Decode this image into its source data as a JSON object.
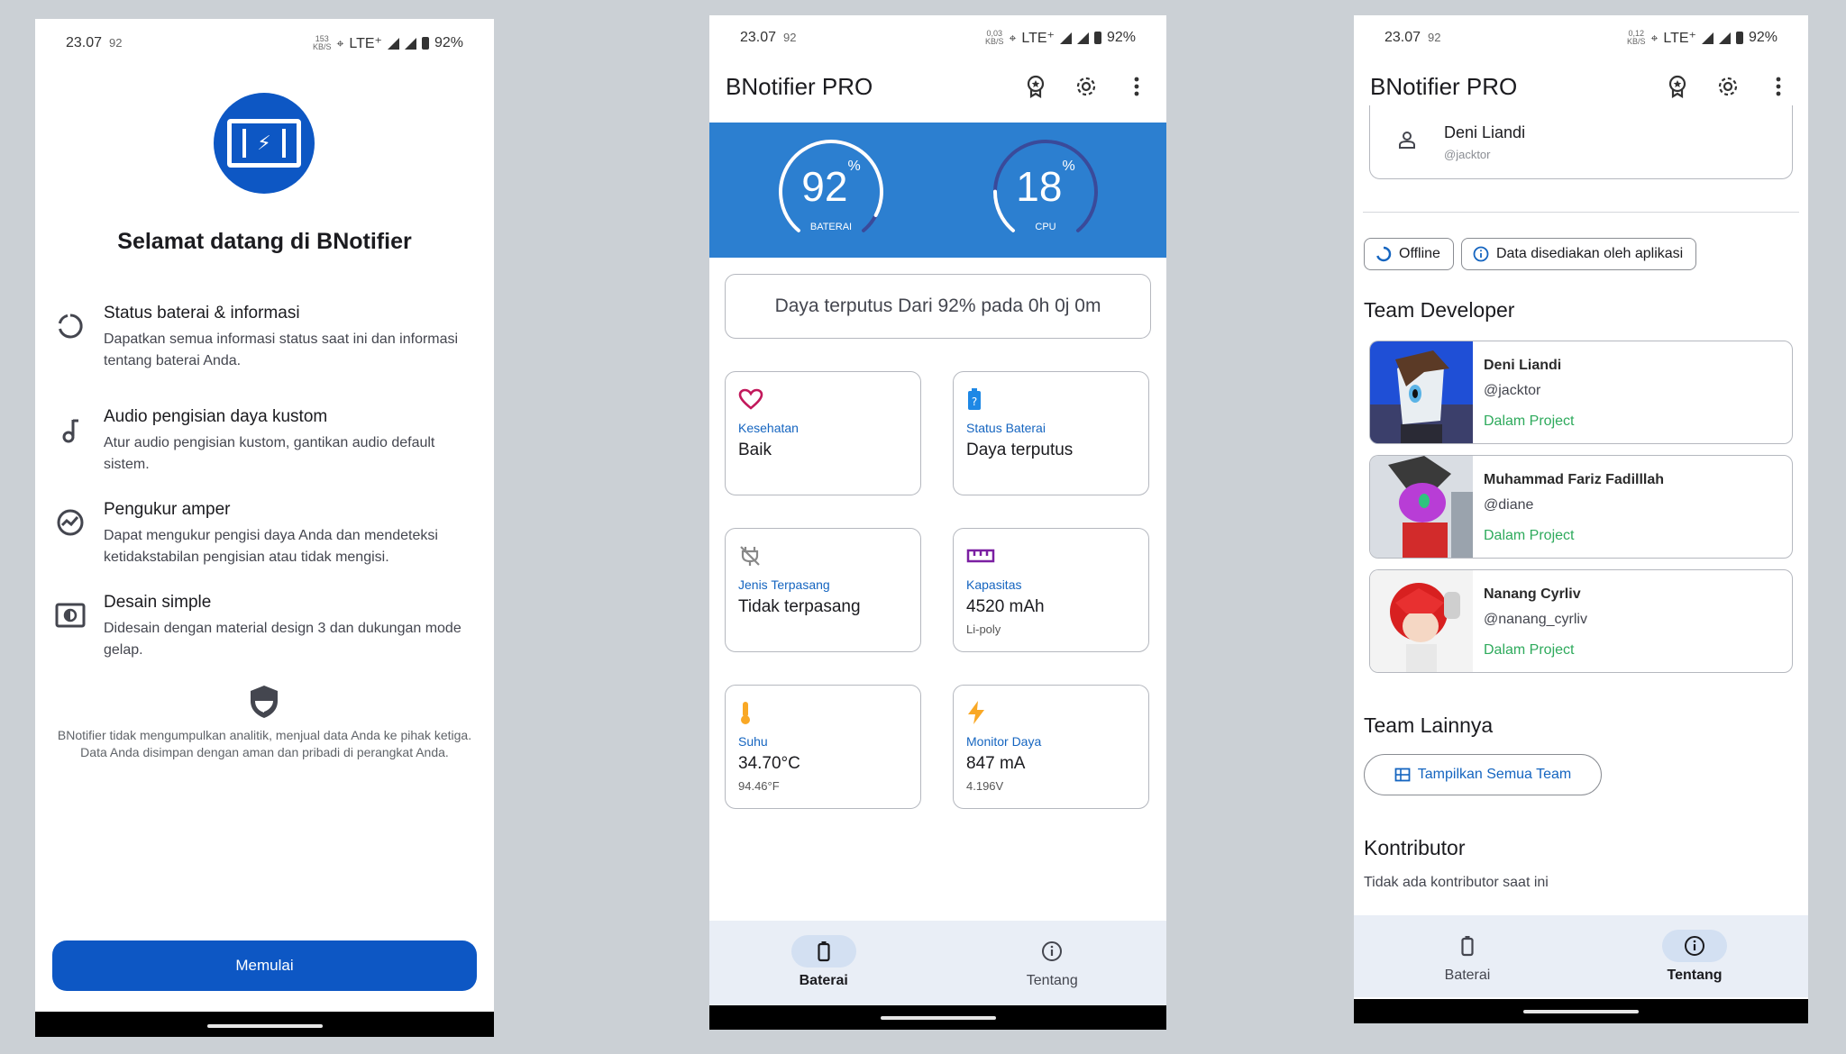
{
  "status": {
    "time": "23.07",
    "seconds": "92",
    "network": "LTE⁺",
    "battery": "92%",
    "kbs_p1": "153",
    "kbs_p2": "0,03",
    "kbs_p3": "0,12",
    "kbs_unit": "KB/S"
  },
  "welcome": {
    "title": "Selamat datang di BNotifier",
    "features": [
      {
        "title": "Status baterai & informasi",
        "desc": "Dapatkan semua informasi status saat ini dan informasi tentang baterai Anda.",
        "icon": "circle-progress-icon"
      },
      {
        "title": "Audio pengisian daya kustom",
        "desc": "Atur audio pengisian kustom, gantikan audio default sistem.",
        "icon": "music-note-icon"
      },
      {
        "title": "Pengukur amper",
        "desc": "Dapat mengukur pengisi daya Anda dan mendeteksi ketidakstabilan pengisian atau tidak mengisi.",
        "icon": "gauge-icon"
      },
      {
        "title": "Desain simple",
        "desc": "Didesain dengan material design 3 dan dukungan mode gelap.",
        "icon": "theme-icon"
      }
    ],
    "privacy": "BNotifier tidak mengumpulkan analitik, menjual data Anda ke pihak ketiga. Data Anda disimpan dengan aman dan pribadi di perangkat Anda.",
    "start_button": "Memulai"
  },
  "app": {
    "title": "BNotifier PRO"
  },
  "battery_screen": {
    "battery_gauge": {
      "value": "92",
      "unit": "%",
      "label": "BATERAI",
      "fraction": 0.92
    },
    "cpu_gauge": {
      "value": "18",
      "unit": "%",
      "label": "CPU",
      "fraction": 0.18
    },
    "disconnected_text": "Daya terputus Dari 92% pada 0h 0j 0m",
    "cards": [
      {
        "label": "Kesehatan",
        "value": "Baik",
        "sub": ""
      },
      {
        "label": "Status Baterai",
        "value": "Daya terputus",
        "sub": ""
      },
      {
        "label": "Jenis Terpasang",
        "value": "Tidak terpasang",
        "sub": ""
      },
      {
        "label": "Kapasitas",
        "value": "4520 mAh",
        "sub": "Li-poly"
      },
      {
        "label": "Suhu",
        "value": "34.70°C",
        "sub": "94.46°F"
      },
      {
        "label": "Monitor Daya",
        "value": "847 mA",
        "sub": "4.196V"
      }
    ]
  },
  "nav": {
    "battery": "Baterai",
    "about": "Tentang"
  },
  "about_screen": {
    "profile": {
      "name": "Deni Liandi",
      "handle": "@jacktor"
    },
    "chips": [
      "Offline",
      "Data disediakan oleh aplikasi"
    ],
    "team_dev_title": "Team Developer",
    "developers": [
      {
        "name": "Deni Liandi",
        "handle": "@jacktor",
        "status": "Dalam Project"
      },
      {
        "name": "Muhammad Fariz Fadilllah",
        "handle": "@diane",
        "status": "Dalam Project"
      },
      {
        "name": "Nanang Cyrliv",
        "handle": "@nanang_cyrliv",
        "status": "Dalam Project"
      }
    ],
    "other_team_title": "Team Lainnya",
    "show_all_team": "Tampilkan Semua Team",
    "contributor_title": "Kontributor",
    "no_contributor": "Tidak ada kontributor saat ini"
  },
  "colors": {
    "primary": "#0d57c4",
    "hero": "#2c7fd0",
    "status_green": "#2eaa5c",
    "label_blue": "#1565c0"
  }
}
